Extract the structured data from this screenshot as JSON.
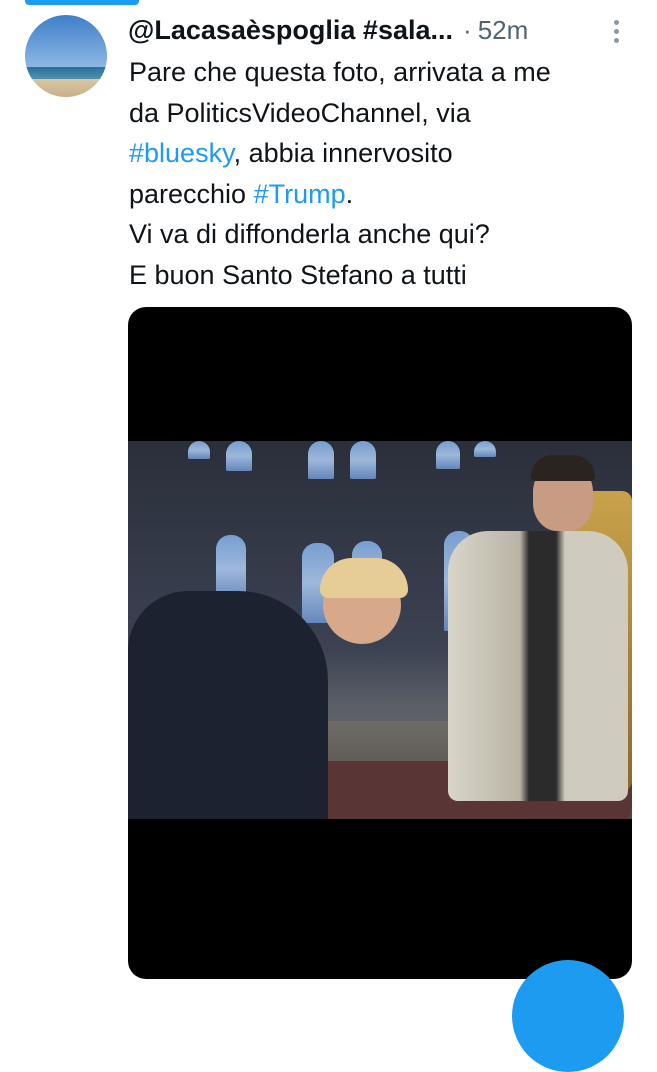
{
  "tweet": {
    "handle": "@Lacasaèspoglia #sala...",
    "separator": "·",
    "time": "52m",
    "text_lines": [
      "Pare che questa foto, arrivata a me",
      "da PoliticsVideoChannel, via",
      "#bluesky",
      ", abbia innervosito",
      "parecchio ",
      "#Trump",
      ".",
      "Vi va di diffonderla anche qui?",
      "E buon Santo Stefano a tutti"
    ]
  },
  "icons": {
    "more": "more-vertical-icon",
    "compose": "compose-fab-icon"
  },
  "colors": {
    "accent": "#1d9bf0",
    "text": "#0f1419",
    "muted": "#536471",
    "media_bg": "#000000"
  }
}
